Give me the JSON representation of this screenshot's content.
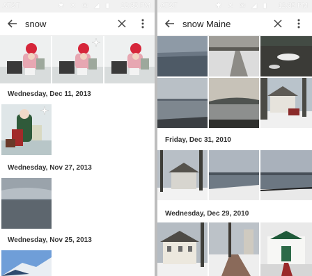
{
  "status": {
    "carrier": "AT&T",
    "icons": "✱ ✕ ✉ ◢ ▮",
    "time": "12:35 PM"
  },
  "left": {
    "search": {
      "query": "snow"
    },
    "groups": [
      {
        "label": "Wednesday, Dec 11, 2013"
      },
      {
        "label": "Wednesday, Nov 27, 2013"
      },
      {
        "label": "Wednesday, Nov 25, 2013"
      }
    ]
  },
  "right": {
    "search": {
      "query": "snow Maine"
    },
    "groups": [
      {
        "label": "Friday, Dec 31, 2010"
      },
      {
        "label": "Wednesday, Dec 29, 2010"
      }
    ]
  },
  "icons": {
    "back": "arrow-left-icon",
    "clear": "close-icon",
    "more": "more-vert-icon",
    "auto_enhance": "sparkle-icon"
  },
  "colors": {
    "toolbar_text": "#212121",
    "section_label": "#333333",
    "status_bg": "#f1f1f1"
  }
}
